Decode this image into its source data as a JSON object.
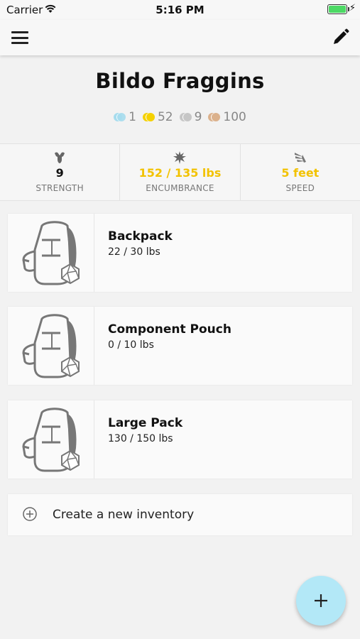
{
  "status_bar": {
    "carrier": "Carrier",
    "time": "5:16 PM",
    "battery_color": "#4cd964"
  },
  "navbar": {
    "left_icon": "hamburger-menu-icon",
    "right_icon": "pencil-edit-icon"
  },
  "character": {
    "name": "Bildo Fraggins"
  },
  "coins": [
    {
      "name": "platinum",
      "value": "1",
      "color": "#a6dcee"
    },
    {
      "name": "gold",
      "value": "52",
      "color": "#f5d100"
    },
    {
      "name": "silver",
      "value": "9",
      "color": "#c6c6c6"
    },
    {
      "name": "copper",
      "value": "100",
      "color": "#dbb18c"
    }
  ],
  "stats": {
    "strength": {
      "value": "9",
      "label": "STRENGTH",
      "icon": "flexing-arm-icon"
    },
    "encumbrance": {
      "value": "152 / 135 lbs",
      "label": "ENCUMBRANCE",
      "icon": "weight-burst-icon"
    },
    "speed": {
      "value": "5 feet",
      "label": "SPEED",
      "icon": "winged-foot-icon"
    }
  },
  "accent_color": "#f2c200",
  "inventories": [
    {
      "name": "Backpack",
      "capacity": "22 / 30 lbs",
      "icon": "backpack-icon"
    },
    {
      "name": "Component Pouch",
      "capacity": "0 / 10 lbs",
      "icon": "backpack-icon"
    },
    {
      "name": "Large Pack",
      "capacity": "130 / 150 lbs",
      "icon": "backpack-icon"
    }
  ],
  "create_inventory": {
    "label": "Create a new inventory",
    "icon": "circle-plus-icon"
  },
  "fab": {
    "icon": "plus-icon",
    "color": "#b3e8f7"
  }
}
